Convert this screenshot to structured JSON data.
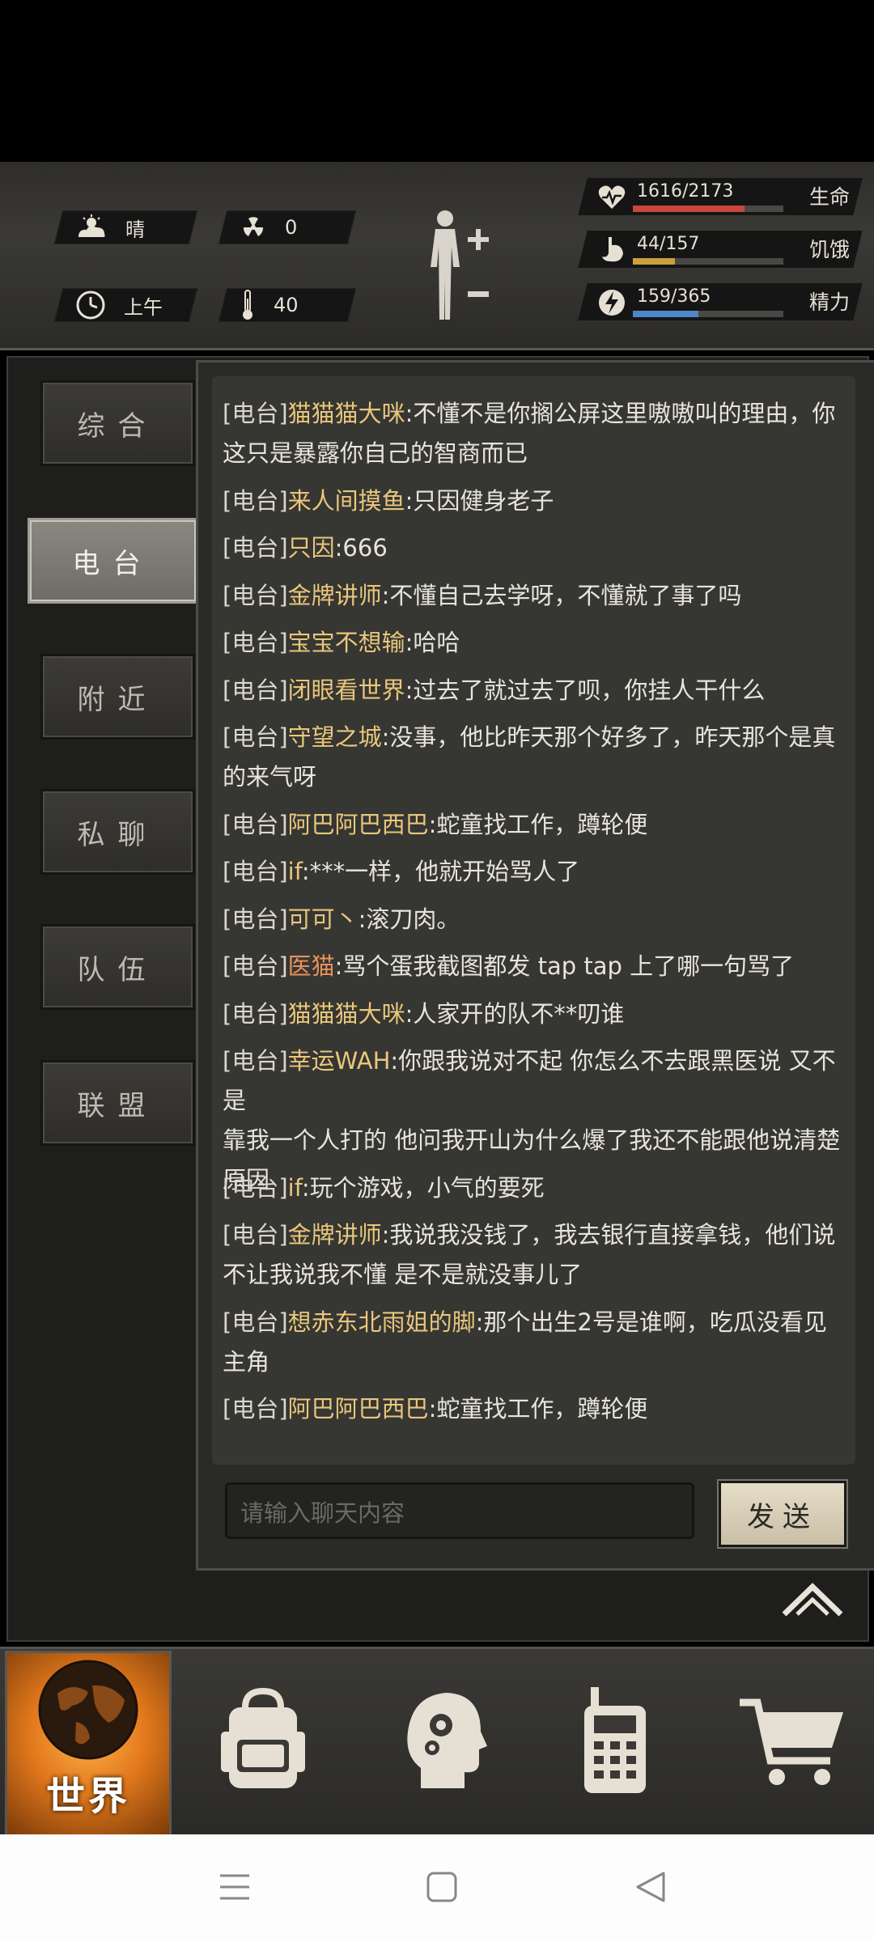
{
  "hud": {
    "weather": "晴",
    "radiation": "0",
    "time": "上午",
    "temperature": "40",
    "stats": [
      {
        "name": "health",
        "value": "1616/2173",
        "label": "生命",
        "fraction": 0.744,
        "color": "#c9483d",
        "icon": "heart-pulse-icon"
      },
      {
        "name": "hunger",
        "value": "44/157",
        "label": "饥饿",
        "fraction": 0.28,
        "color": "#c9a23a",
        "icon": "stomach-icon"
      },
      {
        "name": "energy",
        "value": "159/365",
        "label": "精力",
        "fraction": 0.436,
        "color": "#4f86c9",
        "icon": "energy-icon"
      }
    ]
  },
  "tabs": [
    {
      "id": "general",
      "label": "综合",
      "active": false
    },
    {
      "id": "radio",
      "label": "电台",
      "active": true
    },
    {
      "id": "nearby",
      "label": "附近",
      "active": false
    },
    {
      "id": "private",
      "label": "私聊",
      "active": false
    },
    {
      "id": "team",
      "label": "队伍",
      "active": false
    },
    {
      "id": "alliance",
      "label": "联盟",
      "active": false
    }
  ],
  "chat": {
    "channel_tag": "[电台]",
    "messages": [
      {
        "name": "猫猫猫大咪",
        "text": ":不懂不是你搁公屏这里嗷嗷叫的理由，你这只是暴露你自己的智商而已",
        "cont": "这只是暴露你自己的智商而已",
        "line1": ":不懂不是你搁公屏这里嗷嗷叫的理由，你",
        "color": "gold"
      },
      {
        "name": "来人间摸鱼",
        "line1": ":只因健身老子",
        "color": "gold"
      },
      {
        "name": "只因",
        "line1": ":666",
        "color": "gold"
      },
      {
        "name": "金牌讲师",
        "line1": ":不懂自己去学呀，不懂就了事了吗",
        "color": "gold"
      },
      {
        "name": "宝宝不想输",
        "line1": ":哈哈",
        "color": "gold"
      },
      {
        "name": "闭眼看世界",
        "line1": ":过去了就过去了呗，你挂人干什么",
        "color": "gold"
      },
      {
        "name": "守望之城",
        "line1": ":没事，他比昨天那个好多了，昨天那个是真",
        "cont": "的来气呀",
        "color": "gold"
      },
      {
        "name": "阿巴阿巴西巴",
        "line1": ":蛇童找工作，蹲轮便",
        "color": "gold"
      },
      {
        "name": "if",
        "line1": ":***一样，他就开始骂人了",
        "color": "gold"
      },
      {
        "name": "可可丶",
        "line1": ":滚刀肉。",
        "color": "gold"
      },
      {
        "name": "医猫",
        "line1": ":骂个蛋我截图都发 tap tap 上了哪一句骂了",
        "color": "orange"
      },
      {
        "name": "猫猫猫大咪",
        "line1": ":人家开的队不**叨谁",
        "color": "gold"
      },
      {
        "name": "幸运WAH",
        "line1": ":你跟我说对不起 你怎么不去跟黑医说 又不是",
        "cont": "靠我一个人打的 他问我开山为什么爆了我还不能跟他说清楚",
        "cont2": "原因",
        "color": "gold"
      },
      {
        "name": "if",
        "line1": ":玩个游戏，小气的要死",
        "color": "gold"
      },
      {
        "name": "金牌讲师",
        "line1": ":我说我没钱了，我去银行直接拿钱，他们说",
        "cont": "不让我说我不懂 是不是就没事儿了",
        "color": "gold"
      },
      {
        "name": "想赤东北雨姐的脚",
        "line1": ":那个出生2号是谁啊，吃瓜没看见",
        "cont": "主角",
        "color": "gold"
      },
      {
        "name": "阿巴阿巴西巴",
        "line1": ":蛇童找工作，蹲轮便",
        "color": "gold"
      }
    ],
    "input_placeholder": "请输入聊天内容",
    "send_label": "发送"
  },
  "bottom_nav": {
    "world_label": "世界",
    "items": [
      "world-icon",
      "backpack-icon",
      "skills-head-icon",
      "radio-device-icon",
      "cart-icon"
    ]
  }
}
